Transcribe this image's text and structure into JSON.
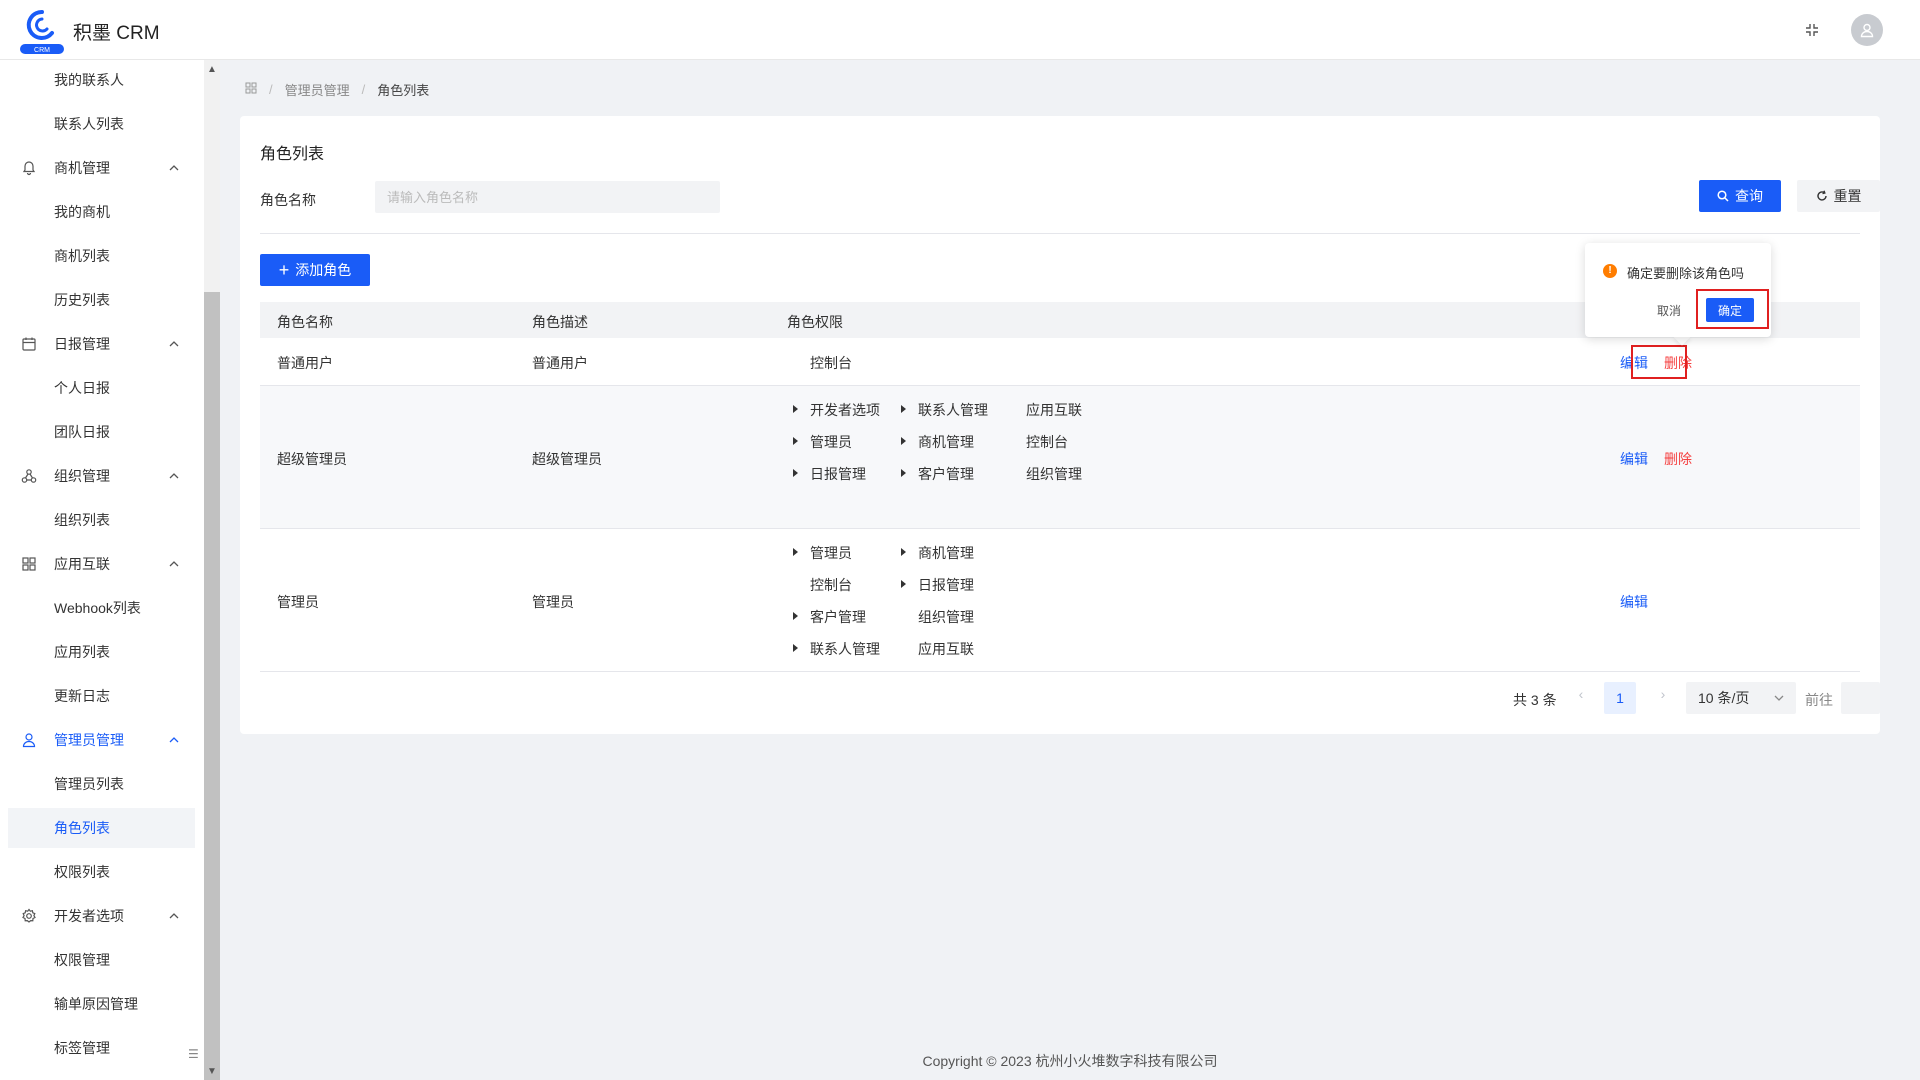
{
  "header": {
    "brand": "积墨 CRM",
    "logo_badge": "CRM"
  },
  "sidebar": {
    "items": [
      {
        "label": "我的联系人",
        "type": "sub"
      },
      {
        "label": "联系人列表",
        "type": "sub"
      },
      {
        "label": "商机管理",
        "type": "group",
        "icon": "bell-icon"
      },
      {
        "label": "我的商机",
        "type": "sub"
      },
      {
        "label": "商机列表",
        "type": "sub"
      },
      {
        "label": "历史列表",
        "type": "sub"
      },
      {
        "label": "日报管理",
        "type": "group",
        "icon": "calendar-icon"
      },
      {
        "label": "个人日报",
        "type": "sub"
      },
      {
        "label": "团队日报",
        "type": "sub"
      },
      {
        "label": "组织管理",
        "type": "group",
        "icon": "org-icon"
      },
      {
        "label": "组织列表",
        "type": "sub"
      },
      {
        "label": "应用互联",
        "type": "group",
        "icon": "grid-icon"
      },
      {
        "label": "Webhook列表",
        "type": "sub"
      },
      {
        "label": "应用列表",
        "type": "sub"
      },
      {
        "label": "更新日志",
        "type": "sub"
      },
      {
        "label": "管理员管理",
        "type": "group",
        "icon": "user-icon",
        "active": true
      },
      {
        "label": "管理员列表",
        "type": "sub"
      },
      {
        "label": "角色列表",
        "type": "sub",
        "active": true
      },
      {
        "label": "权限列表",
        "type": "sub"
      },
      {
        "label": "开发者选项",
        "type": "group",
        "icon": "gear-icon"
      },
      {
        "label": "权限管理",
        "type": "sub"
      },
      {
        "label": "输单原因管理",
        "type": "sub"
      },
      {
        "label": "标签管理",
        "type": "sub"
      }
    ]
  },
  "breadcrumb": {
    "items": [
      "管理员管理",
      "角色列表"
    ]
  },
  "main": {
    "title": "角色列表",
    "filter_label": "角色名称",
    "filter_placeholder": "请输入角色名称",
    "search_label": "查询",
    "reset_label": "重置",
    "add_label": "添加角色",
    "columns": [
      "角色名称",
      "角色描述",
      "角色权限"
    ],
    "edit_label": "编辑",
    "delete_label": "删除",
    "rows": [
      {
        "name": "普通用户",
        "desc": "普通用户",
        "perms": [
          {
            "label": "控制台",
            "caret": false
          }
        ],
        "deletable": true
      },
      {
        "name": "超级管理员",
        "desc": "超级管理员",
        "perms": [
          {
            "label": "开发者选项",
            "caret": true
          },
          {
            "label": "联系人管理",
            "caret": true
          },
          {
            "label": "应用互联",
            "caret": false
          },
          {
            "label": "管理员",
            "caret": true
          },
          {
            "label": "商机管理",
            "caret": true
          },
          {
            "label": "控制台",
            "caret": false
          },
          {
            "label": "日报管理",
            "caret": true
          },
          {
            "label": "客户管理",
            "caret": true
          },
          {
            "label": "组织管理",
            "caret": false
          }
        ],
        "deletable": true
      },
      {
        "name": "管理员",
        "desc": "管理员",
        "perms": [
          {
            "label": "管理员",
            "caret": true
          },
          {
            "label": "商机管理",
            "caret": true
          },
          {
            "label": "控制台",
            "caret": false
          },
          {
            "label": "日报管理",
            "caret": true
          },
          {
            "label": "客户管理",
            "caret": true
          },
          {
            "label": "组织管理",
            "caret": false
          },
          {
            "label": "联系人管理",
            "caret": true
          },
          {
            "label": "应用互联",
            "caret": false
          }
        ],
        "deletable": false
      }
    ]
  },
  "pagination": {
    "total": "共 3 条",
    "prev": "‹",
    "current": "1",
    "next": "›",
    "page_size": "10 条/页",
    "goto_label": "前往"
  },
  "popconfirm": {
    "message": "确定要删除该角色吗",
    "cancel": "取消",
    "ok": "确定"
  },
  "footer": {
    "copyright": "Copyright © 2023 杭州小火堆数字科技有限公司"
  },
  "colors": {
    "accent": "#1a5cf7",
    "danger": "#f53f3f",
    "warning": "#ff7d00",
    "highlight": "#e02020"
  }
}
